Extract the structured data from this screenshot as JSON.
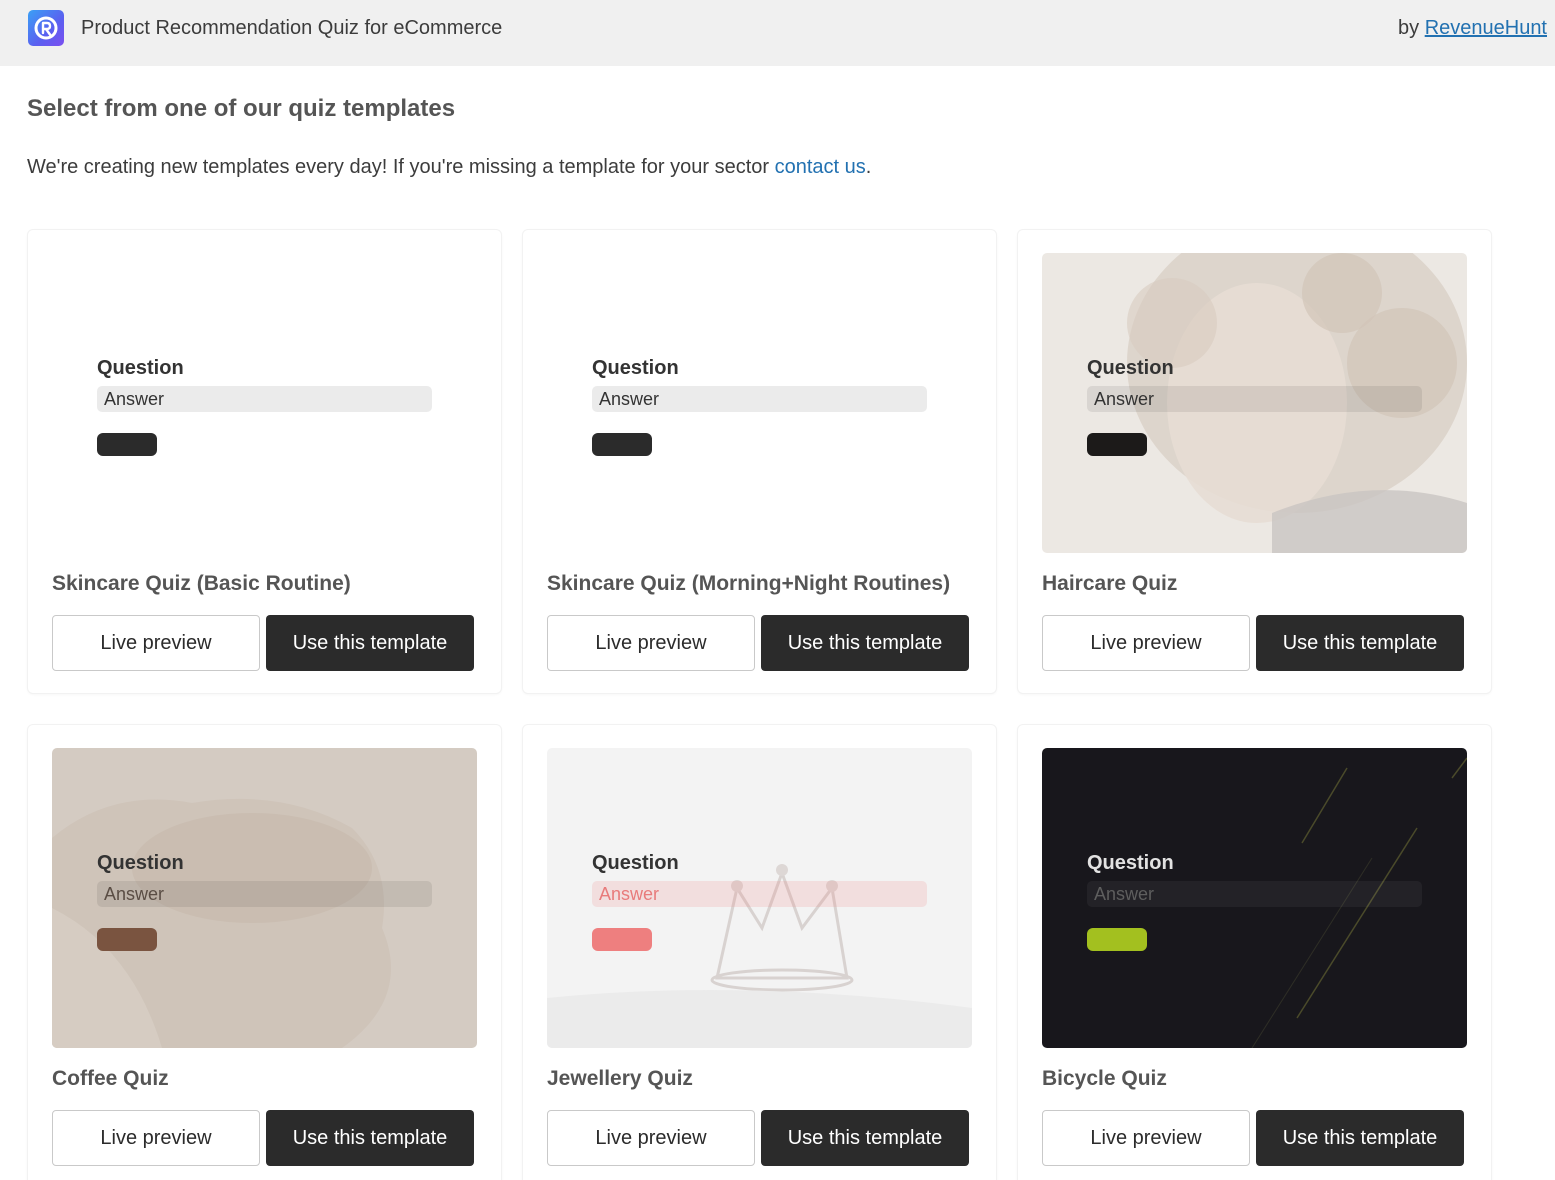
{
  "header": {
    "app_title": "Product Recommendation Quiz for eCommerce",
    "by_prefix": "by",
    "by_link": "RevenueHunt",
    "logo_icon": "revenuehunt-logo-icon"
  },
  "main": {
    "heading": "Select from one of our quiz templates",
    "intro_text": "We're creating new templates every day! If you're missing a template for your sector ",
    "intro_link": "contact us",
    "intro_end": "."
  },
  "templates": [
    {
      "name": "Skincare Quiz (Basic Routine)",
      "question": "Question",
      "answer": "Answer",
      "live_label": "Live preview",
      "use_label": "Use this template",
      "accent": "#2b2b2b"
    },
    {
      "name": "Skincare Quiz (Morning+Night Routines)",
      "question": "Question",
      "answer": "Answer",
      "live_label": "Live preview",
      "use_label": "Use this template",
      "accent": "#2b2b2b"
    },
    {
      "name": "Haircare Quiz",
      "question": "Question",
      "answer": "Answer",
      "live_label": "Live preview",
      "use_label": "Use this template",
      "accent": "#1c1a19"
    },
    {
      "name": "Coffee Quiz",
      "question": "Question",
      "answer": "Answer",
      "live_label": "Live preview",
      "use_label": "Use this template",
      "accent": "#7a5440"
    },
    {
      "name": "Jewellery Quiz",
      "question": "Question",
      "answer": "Answer",
      "live_label": "Live preview",
      "use_label": "Use this template",
      "accent": "#ee7f7f"
    },
    {
      "name": "Bicycle Quiz",
      "question": "Question",
      "answer": "Answer",
      "live_label": "Live preview",
      "use_label": "Use this template",
      "accent": "#a3c01f"
    }
  ]
}
